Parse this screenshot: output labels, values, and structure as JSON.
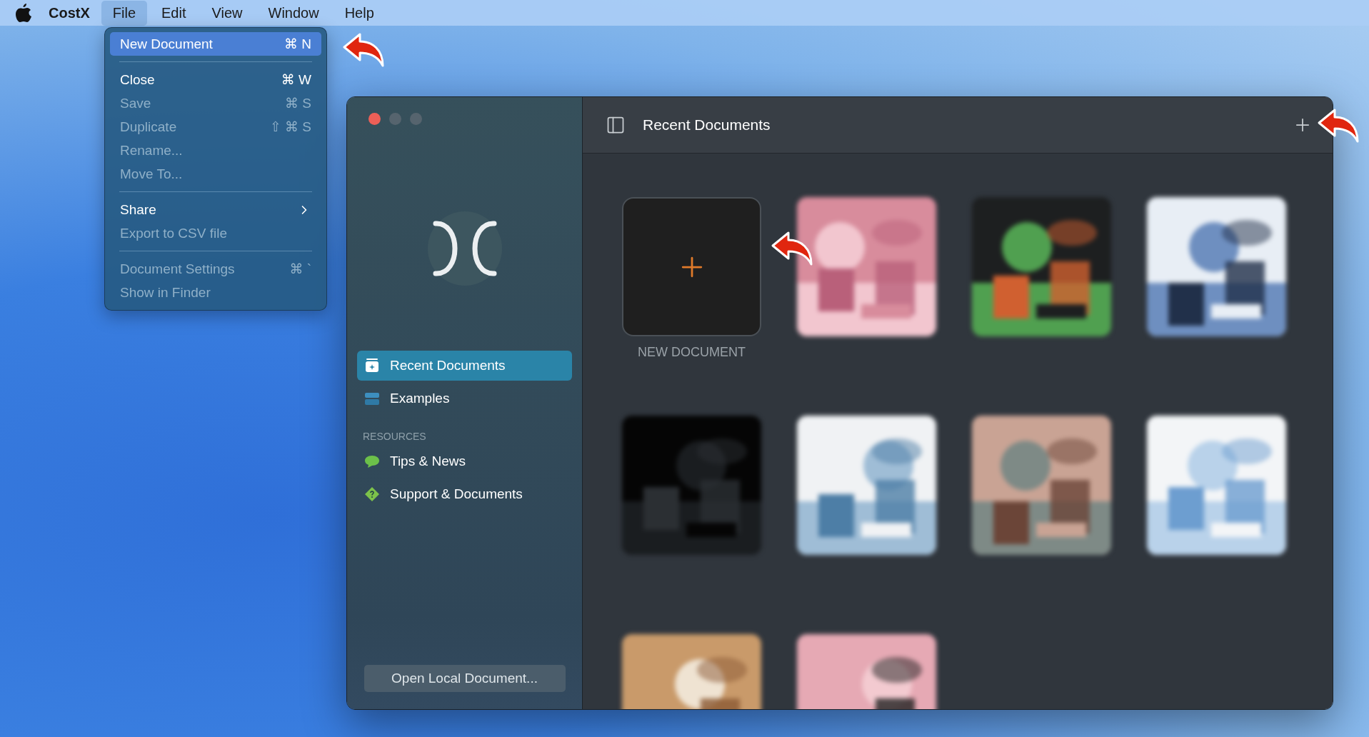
{
  "menu_bar": {
    "app_name": "CostX",
    "menus": [
      {
        "label": "File",
        "selected": true
      },
      {
        "label": "Edit",
        "selected": false
      },
      {
        "label": "View",
        "selected": false
      },
      {
        "label": "Window",
        "selected": false
      },
      {
        "label": "Help",
        "selected": false
      }
    ]
  },
  "file_menu": {
    "items": [
      {
        "kind": "item",
        "label": "New Document",
        "shortcut": "⌘ N",
        "selected": true,
        "disabled": false
      },
      {
        "kind": "separator"
      },
      {
        "kind": "item",
        "label": "Close",
        "shortcut": "⌘ W",
        "selected": false,
        "disabled": false
      },
      {
        "kind": "item",
        "label": "Save",
        "shortcut": "⌘ S",
        "selected": false,
        "disabled": true
      },
      {
        "kind": "item",
        "label": "Duplicate",
        "shortcut": "⇧ ⌘ S",
        "selected": false,
        "disabled": true
      },
      {
        "kind": "item",
        "label": "Rename...",
        "selected": false,
        "disabled": true
      },
      {
        "kind": "item",
        "label": "Move To...",
        "selected": false,
        "disabled": true
      },
      {
        "kind": "separator"
      },
      {
        "kind": "submenu",
        "label": "Share",
        "selected": false,
        "disabled": false
      },
      {
        "kind": "item",
        "label": "Export to CSV file",
        "selected": false,
        "disabled": true
      },
      {
        "kind": "separator"
      },
      {
        "kind": "item",
        "label": "Document Settings",
        "shortcut": "⌘ `",
        "selected": false,
        "disabled": true
      },
      {
        "kind": "item",
        "label": "Show in Finder",
        "selected": false,
        "disabled": true
      }
    ]
  },
  "window": {
    "sidebar": {
      "items": [
        {
          "kind": "recent",
          "label": "Recent Documents",
          "selected": true
        },
        {
          "kind": "examples",
          "label": "Examples",
          "selected": false
        }
      ],
      "resources_heading": "RESOURCES",
      "resources": [
        {
          "kind": "tips",
          "label": "Tips & News",
          "selected": false
        },
        {
          "kind": "support",
          "label": "Support & Documents",
          "selected": false
        }
      ],
      "open_button": "Open Local Document..."
    },
    "header": {
      "title": "Recent Documents"
    },
    "documents": [
      {
        "kind": "new",
        "label": "NEW DOCUMENT"
      },
      {
        "kind": "picture"
      },
      {
        "kind": "picture"
      },
      {
        "kind": "picture"
      },
      {
        "kind": "picture"
      },
      {
        "kind": "picture"
      },
      {
        "kind": "picture"
      },
      {
        "kind": "picture"
      },
      {
        "kind": "picture"
      },
      {
        "kind": "picture"
      }
    ]
  }
}
